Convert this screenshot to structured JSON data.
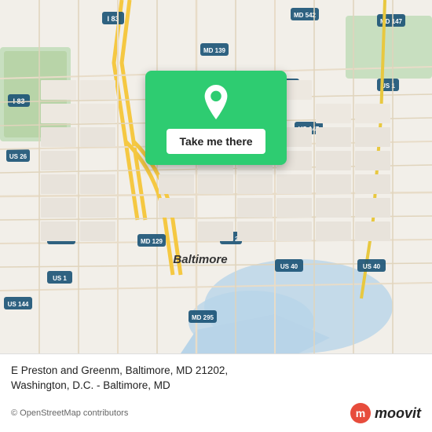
{
  "map": {
    "center_city": "Baltimore",
    "background_color": "#f2efe9"
  },
  "location_card": {
    "button_label": "Take me there",
    "pin_color": "#ffffff"
  },
  "bottom_panel": {
    "address_line1": "E Preston and Greenm, Baltimore, MD 21202,",
    "address_line2": "Washington, D.C. - Baltimore, MD",
    "copyright": "© OpenStreetMap contributors"
  },
  "moovit": {
    "brand_name": "moovit",
    "icon_colors": {
      "body": "#e74c3c",
      "text": "#222222"
    }
  }
}
